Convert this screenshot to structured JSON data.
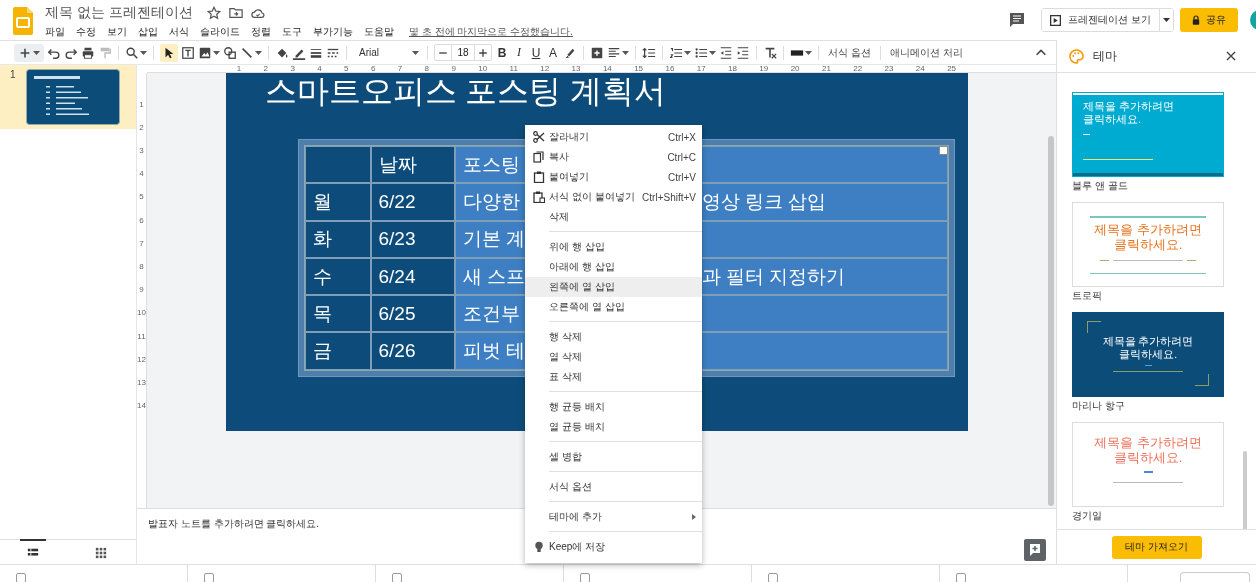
{
  "header": {
    "title": "제목 없는 프레젠테이션",
    "menus": [
      "파일",
      "수정",
      "보기",
      "삽입",
      "서식",
      "슬라이드",
      "정렬",
      "도구",
      "부가기능",
      "도움말"
    ],
    "last_edit": "몇 초 전에 마지막으로 수정했습니다.",
    "present_button": "프레젠테이션 보기",
    "share_button": "공유"
  },
  "toolbar": {
    "select_tool": {
      "selected": true
    },
    "font": "Arial",
    "font_size": "18",
    "format_buttons": [
      "B",
      "I",
      "U",
      "A"
    ],
    "text_buttons": [
      "서식 옵션",
      "애니메이션 처리"
    ]
  },
  "filmstrip": {
    "slides": [
      {
        "number": "1",
        "selected": true
      }
    ],
    "view_tabs": [
      {
        "selected": true
      },
      {
        "selected": false
      }
    ]
  },
  "rulers": {
    "horizontal": [
      "1",
      "2",
      "3",
      "4",
      "5",
      "6",
      "7",
      "8",
      "9",
      "10",
      "11",
      "12",
      "13",
      "14",
      "15",
      "16",
      "17",
      "18",
      "19",
      "20",
      "21",
      "22",
      "23",
      "24",
      "25"
    ],
    "vertical": [
      "1",
      "2",
      "3",
      "4",
      "5",
      "6",
      "7",
      "8",
      "9",
      "10",
      "11",
      "12",
      "13",
      "14"
    ]
  },
  "slide": {
    "title": "스마트오피스 포스팅 계획서",
    "table": {
      "columns": [
        {
          "selected": false
        },
        {
          "label": "날짜",
          "selected": false
        },
        {
          "label": "포스팅",
          "selected": true
        }
      ],
      "rows": [
        {
          "cells": [
            "월",
            "6/22",
            "다양한"
          ],
          "after_menu": "영상 링크 삽입"
        },
        {
          "cells": [
            "화",
            "6/23",
            "기본 계"
          ]
        },
        {
          "cells": [
            "수",
            "6/24",
            "새 스프"
          ],
          "after_menu": "과 필터 지정하기"
        },
        {
          "cells": [
            "목",
            "6/25",
            "조건부"
          ]
        },
        {
          "cells": [
            "금",
            "6/26",
            "피벗 테"
          ]
        }
      ]
    }
  },
  "notes": {
    "placeholder": "발표자 노트를 추가하려면 클릭하세요."
  },
  "context_menu": {
    "groups": [
      [
        {
          "label": "잘라내기",
          "shortcut": "Ctrl+X",
          "kind": "cut",
          "highlighted": false
        },
        {
          "label": "복사",
          "shortcut": "Ctrl+C",
          "kind": "copy",
          "highlighted": false
        },
        {
          "label": "붙여넣기",
          "shortcut": "Ctrl+V",
          "kind": "paste",
          "highlighted": false
        },
        {
          "label": "서식 없이 붙여넣기",
          "shortcut": "Ctrl+Shift+V",
          "kind": "pasteplain",
          "highlighted": false
        },
        {
          "label": "삭제",
          "kind": "plain",
          "highlighted": false
        }
      ],
      [
        {
          "label": "위에 행 삽입",
          "kind": "plain",
          "highlighted": false
        },
        {
          "label": "아래에 행 삽입",
          "kind": "plain",
          "highlighted": false
        },
        {
          "label": "왼쪽에 열 삽입",
          "kind": "plain",
          "highlighted": true
        },
        {
          "label": "오른쪽에 열 삽입",
          "kind": "plain",
          "highlighted": false
        }
      ],
      [
        {
          "label": "행 삭제",
          "kind": "plain",
          "highlighted": false
        },
        {
          "label": "열 삭제",
          "kind": "plain",
          "highlighted": false
        },
        {
          "label": "표 삭제",
          "kind": "plain",
          "highlighted": false
        }
      ],
      [
        {
          "label": "행 균등 배치",
          "kind": "plain",
          "highlighted": false
        },
        {
          "label": "열 균등 배치",
          "kind": "plain",
          "highlighted": false
        }
      ],
      [
        {
          "label": "셀 병합",
          "kind": "plain",
          "highlighted": false
        }
      ],
      [
        {
          "label": "서식 옵션",
          "kind": "plain",
          "highlighted": false
        }
      ],
      [
        {
          "label": "테마에 추가",
          "kind": "submenu",
          "highlighted": false
        }
      ],
      [
        {
          "label": "Keep에 저장",
          "kind": "keep",
          "highlighted": false
        }
      ]
    ]
  },
  "theme_panel": {
    "title": "테마",
    "themes": [
      {
        "kind": "banner",
        "title": "제목을 추가하려면 클릭하세요.",
        "name": "블루 앤 골드"
      },
      {
        "kind": "lined",
        "title": "제목을 추가하려면 클릭하세요.",
        "name": "트로픽"
      },
      {
        "kind": "framed",
        "title": "제목을 추가하려면 클릭하세요.",
        "name": "마리나 항구"
      },
      {
        "kind": "minimal",
        "title": "제목을 추가하려면 클릭하세요."
      }
    ],
    "last_theme_name": "경기일",
    "import_button": "테마 가져오기"
  }
}
